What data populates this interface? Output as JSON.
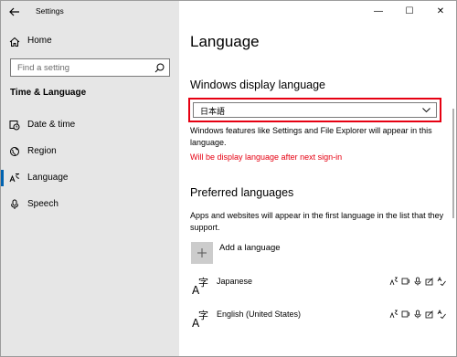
{
  "app": {
    "title": "Settings"
  },
  "window_controls": {
    "minimize": "—",
    "maximize": "☐",
    "close": "✕"
  },
  "sidebar": {
    "home_label": "Home",
    "search_placeholder": "Find a setting",
    "section_title": "Time & Language",
    "items": [
      {
        "label": "Date & time",
        "icon": "clock-icon"
      },
      {
        "label": "Region",
        "icon": "globe-icon"
      },
      {
        "label": "Language",
        "icon": "language-icon",
        "active": true
      },
      {
        "label": "Speech",
        "icon": "microphone-icon"
      }
    ]
  },
  "main": {
    "page_title": "Language",
    "display_language": {
      "heading": "Windows display language",
      "selected_value": "日本語",
      "description": "Windows features like Settings and File Explorer will appear in this language.",
      "warning": "Will be display language after next sign-in",
      "highlight_color": "#e60012"
    },
    "preferred": {
      "heading": "Preferred languages",
      "description": "Apps and websites will appear in the first language in the list that they support.",
      "add_label": "Add a language",
      "languages": [
        {
          "name": "Japanese"
        },
        {
          "name": "English (United States)"
        }
      ]
    }
  },
  "colors": {
    "accent": "#0063b1",
    "sidebar_bg": "#e6e6e6",
    "warning": "#e60012"
  }
}
